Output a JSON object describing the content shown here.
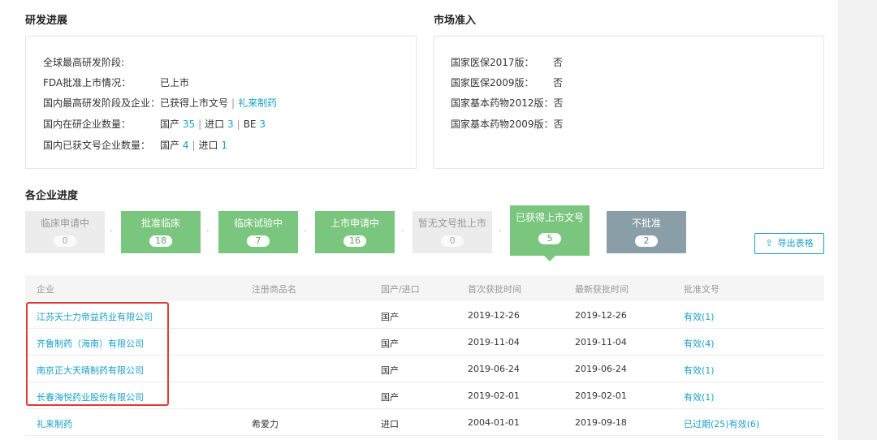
{
  "rd": {
    "title": "研发进展",
    "global_stage_label": "全球最高研发阶段:",
    "fda_label": "FDA批准上市情况：",
    "fda_value": "已上市",
    "domestic_stage_label": "国内最高研发阶段及企业：",
    "domestic_stage_value": "已获得上市文号",
    "domestic_stage_company": "礼来制药",
    "research_count_label": "国内在研企业数量：",
    "research_domestic_label": "国产",
    "research_domestic_count": "35",
    "research_import_label": "进口",
    "research_import_count": "3",
    "research_be_label": "BE",
    "research_be_count": "3",
    "approved_count_label": "国内已获文号企业数量：",
    "approved_domestic_label": "国产",
    "approved_domestic_count": "4",
    "approved_import_label": "进口",
    "approved_import_count": "1"
  },
  "market": {
    "title": "市场准入",
    "items": [
      {
        "label": "国家医保2017版：",
        "value": "否"
      },
      {
        "label": "国家医保2009版：",
        "value": "否"
      },
      {
        "label": "国家基本药物2012版：",
        "value": "否"
      },
      {
        "label": "国家基本药物2009版：",
        "value": "否"
      }
    ]
  },
  "progress": {
    "title": "各企业进度",
    "stages": [
      {
        "label": "临床申请中",
        "count": "0",
        "style": "gray"
      },
      {
        "label": "批准临床",
        "count": "18",
        "style": "green"
      },
      {
        "label": "临床试验中",
        "count": "7",
        "style": "green"
      },
      {
        "label": "上市申请中",
        "count": "16",
        "style": "green"
      },
      {
        "label": "暂无文号批上市",
        "count": "0",
        "style": "gray"
      },
      {
        "label": "已获得上市文号",
        "count": "5",
        "style": "green",
        "selected": true
      },
      {
        "label": "不批准",
        "count": "2",
        "style": "slate"
      }
    ],
    "export_icon": "upload-icon",
    "export_label": "导出表格"
  },
  "table": {
    "headers": [
      "企业",
      "注册商品名",
      "国产/进口",
      "首次获批时间",
      "最新获批时间",
      "批准文号"
    ],
    "rows": [
      {
        "company": "江苏天士力帝益药业有限公司",
        "brand": "",
        "origin": "国产",
        "first": "2019-12-26",
        "latest": "2019-12-26",
        "approval": "有效(1)"
      },
      {
        "company": "齐鲁制药（海南）有限公司",
        "brand": "",
        "origin": "国产",
        "first": "2019-11-04",
        "latest": "2019-11-04",
        "approval": "有效(4)"
      },
      {
        "company": "南京正大天晴制药有限公司",
        "brand": "",
        "origin": "国产",
        "first": "2019-06-24",
        "latest": "2019-06-24",
        "approval": "有效(1)"
      },
      {
        "company": "长春海悦药业股份有限公司",
        "brand": "",
        "origin": "国产",
        "first": "2019-02-01",
        "latest": "2019-02-01",
        "approval": "有效(1)"
      },
      {
        "company": "礼来制药",
        "brand": "希爱力",
        "origin": "进口",
        "first": "2004-01-01",
        "latest": "2019-09-18",
        "approval": "已过期(25)有效(6)"
      }
    ]
  },
  "colors": {
    "link": "#1aa0c9",
    "stage_green": "#7bc67e",
    "stage_gray": "#ececec",
    "stage_slate": "#8a9ea8",
    "highlight_box": "#e53935"
  }
}
